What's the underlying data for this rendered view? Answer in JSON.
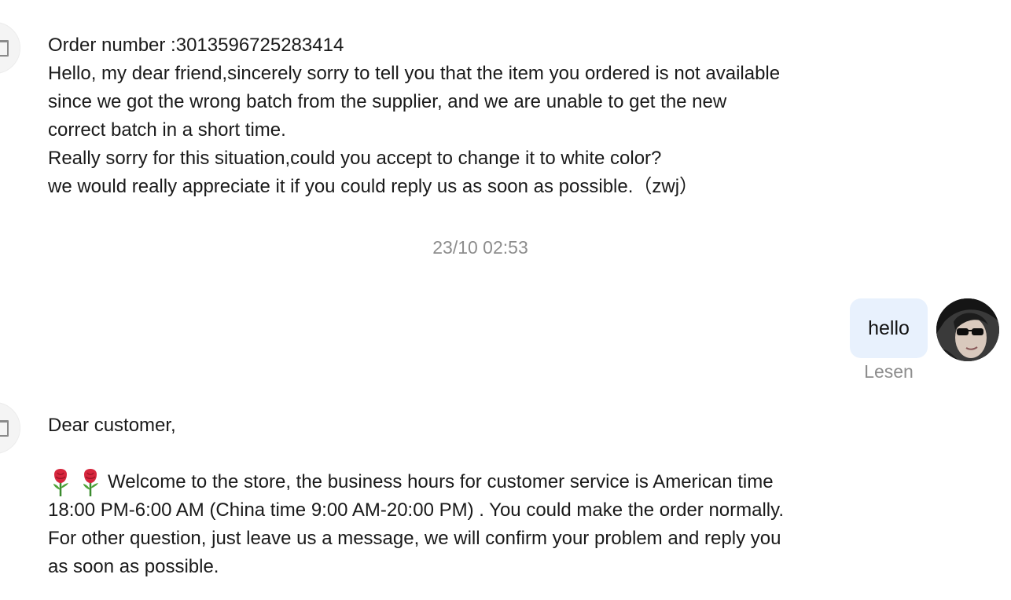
{
  "messages_in_1": {
    "order_line": "Order number :3013596725283414",
    "lines": [
      "Hello, my dear friend,sincerely sorry to tell you that the item you ordered is not available",
      "since we got the wrong batch from the supplier, and we are unable to get the new",
      "correct batch in a short time.",
      "Really sorry for this situation,could you accept to change it to white color?",
      "we would really appreciate it if you could reply us as soon as possible.（zwj）"
    ]
  },
  "timestamp": "23/10 02:53",
  "message_out": {
    "text": "hello",
    "status": "Lesen"
  },
  "messages_in_2": {
    "greeting": "Dear customer,",
    "emoji": "rose-icon",
    "lines": [
      "Welcome to the store, the business hours for customer service is American time",
      "18:00 PM-6:00 AM (China time 9:00 AM-20:00 PM) . You could make the order normally.",
      "For other question, just leave us a message, we will confirm your problem and reply you",
      "as soon as possible."
    ]
  },
  "colors": {
    "outgoing_bubble": "#e8f1fd",
    "meta_text": "#8d8d8d",
    "body_text": "#1a1a1a"
  }
}
